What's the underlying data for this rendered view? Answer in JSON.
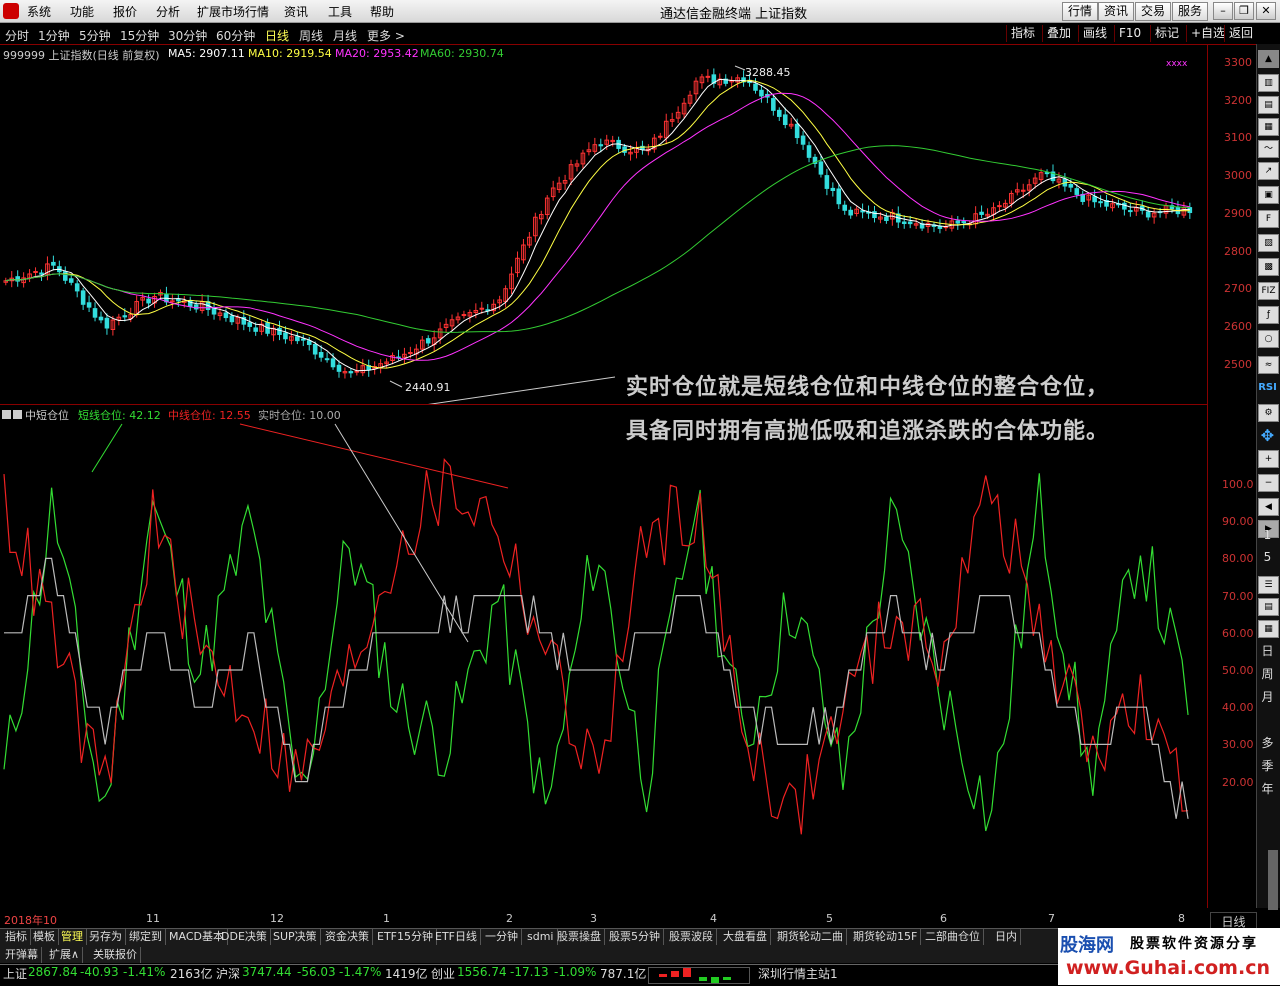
{
  "menubar": {
    "items": [
      "系统",
      "功能",
      "报价",
      "分析",
      "扩展市场行情",
      "资讯",
      "工具",
      "帮助"
    ],
    "title": "通达信金融终端   上证指数",
    "tools": [
      "行情",
      "资讯",
      "交易",
      "服务"
    ]
  },
  "periodbar": {
    "periods": [
      "分时",
      "1分钟",
      "5分钟",
      "15分钟",
      "30分钟",
      "60分钟",
      "日线",
      "周线",
      "月线",
      "更多 >"
    ],
    "active_index": 6,
    "right_tabs": [
      "指标",
      "叠加",
      "画线",
      "F10",
      "标记",
      "+自选",
      "返回"
    ]
  },
  "main_chart": {
    "header_name": "999999 上证指数(日线 前复权)",
    "ma5": "MA5: 2907.11",
    "ma10": "MA10: 2919.54",
    "ma20": "MA20: 2953.42",
    "ma60": "MA60: 2930.74",
    "high_label": "3288.45",
    "low_label": "2440.91",
    "y_ticks": [
      "3300",
      "3200",
      "3100",
      "3000",
      "2900",
      "2800",
      "2700",
      "2600",
      "2500"
    ],
    "colors": {
      "up": "#ff3333",
      "down": "#33dddd",
      "ma5": "#ffffff",
      "ma10": "#ffff44",
      "ma20": "#ff33ff",
      "ma60": "#33cc33"
    }
  },
  "osc_chart": {
    "name": "中短仓位",
    "short_label": "短线仓位: 42.12",
    "mid_label": "中线仓位: 12.55",
    "real_label": "实时仓位: 10.00",
    "y_ticks": [
      "100.0",
      "90.00",
      "80.00",
      "70.00",
      "60.00",
      "50.00",
      "40.00",
      "30.00",
      "20.00"
    ],
    "colors": {
      "short": "#33dd33",
      "mid": "#ee2222",
      "real": "#bbbbbb"
    }
  },
  "annotation": {
    "line1": "实时仓位就是短线仓位和中线仓位的整合仓位，",
    "line2": "具备同时拥有高抛低吸和追涨杀跌的合体功能。"
  },
  "chart_data": {
    "type": "line",
    "title": "999999 上证指数(日线 前复权)",
    "x": [
      "2018年10",
      "11",
      "12",
      "1",
      "2",
      "3",
      "4",
      "5",
      "6",
      "7",
      "8"
    ],
    "series": [
      {
        "name": "上证指数 close",
        "values": [
          2720,
          2760,
          2600,
          2680,
          2650,
          2600,
          2560,
          2470,
          2520,
          2600,
          2670,
          2950,
          3090,
          3060,
          3250,
          3260,
          3120,
          2900,
          2890,
          2860,
          2900,
          3000,
          2930,
          2900,
          2910
        ]
      },
      {
        "name": "短线仓位",
        "values": [
          20,
          95,
          10,
          95,
          50,
          90,
          15,
          85,
          40,
          30,
          70,
          10,
          85,
          20,
          95,
          30,
          70,
          20,
          90,
          45,
          10,
          95,
          20,
          85,
          42.12
        ]
      },
      {
        "name": "中线仓位",
        "values": [
          95,
          60,
          15,
          90,
          55,
          40,
          20,
          50,
          85,
          100,
          90,
          55,
          20,
          85,
          95,
          35,
          10,
          40,
          65,
          55,
          100,
          60,
          30,
          40,
          12.55
        ]
      },
      {
        "name": "实时仓位",
        "values": [
          60,
          75,
          30,
          60,
          40,
          55,
          20,
          50,
          60,
          65,
          70,
          60,
          45,
          60,
          70,
          40,
          30,
          40,
          70,
          50,
          70,
          55,
          30,
          40,
          10.0
        ]
      }
    ],
    "ylim_price": [
      2400,
      3320
    ],
    "ylim_osc": [
      0,
      110
    ]
  },
  "axis": {
    "label": "日线"
  },
  "sidebar": {
    "buttons": [
      "FIZ",
      "RSI",
      "1",
      "5",
      "日",
      "周",
      "月",
      "多",
      "季",
      "年"
    ]
  },
  "tabs": [
    "指标",
    "模板",
    "管理",
    "另存为",
    "绑定到",
    "MACD基本",
    "DDE决策",
    "SUP决策",
    "资金决策",
    "ETF15分钟",
    "ETF日线",
    "一分钟",
    "sdmi",
    "股票操盘",
    "股票5分钟",
    "股票波段",
    "大盘看盘",
    "期货轮动二曲",
    "期货轮动15F",
    "二部曲仓位",
    "日内"
  ],
  "tabs_active_index": 2,
  "tabs2": [
    "开弹幕",
    "扩展∧",
    "关联报价"
  ],
  "status": {
    "sh_name": "上证",
    "sh_val": "2867.84",
    "sh_chg": "-40.93",
    "sh_pct": "-1.41%",
    "sh_amt": "2163亿",
    "hs_name": "沪深",
    "hs_val": "3747.44",
    "hs_chg": "-56.03",
    "hs_pct": "-1.47%",
    "hs_amt": "1419亿",
    "cy_name": "创业",
    "cy_val": "1556.74",
    "cy_chg": "-17.13",
    "cy_pct": "-1.09%",
    "cy_amt": "787.1亿",
    "server": "深圳行情主站1"
  },
  "watermark": {
    "brand": "股海网",
    "slogan": "股票软件资源分享",
    "url": "www.Guhai.com.cn"
  }
}
